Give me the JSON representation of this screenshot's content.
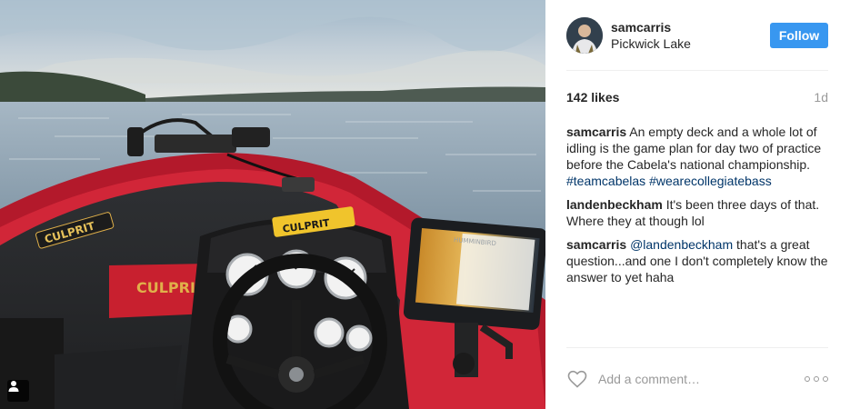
{
  "post": {
    "author": {
      "username": "samcarris",
      "location": "Pickwick Lake",
      "avatar_icon": "avatar"
    },
    "follow_label": "Follow",
    "likes": "142 likes",
    "time": "1d",
    "photo_overlay_text": {
      "console_brand": "CULPRIT",
      "hull_brand": "CULPRIT",
      "gauge_pod_brand": "CULPRIT",
      "graph_brand": "HUMMINBIRD"
    },
    "comments": [
      {
        "author": "samcarris",
        "parts": [
          "An empty deck and a whole lot of idling is the game plan for day two of practice before the Cabela's national championship. ",
          "#teamcabelas",
          " ",
          "#wearecollegiatebass"
        ]
      },
      {
        "author": "landenbeckham",
        "parts": [
          "It's been three days of that. Where they at though lol"
        ]
      },
      {
        "author": "samcarris",
        "parts": [
          "@landenbeckham",
          " that's a great question...and one I don't completely know the answer to yet haha"
        ]
      }
    ],
    "add_comment_placeholder": "Add a comment…"
  },
  "icons": {
    "like": "heart-icon",
    "more": "more-options-icon",
    "user_tag": "user-tag-icon"
  },
  "colors": {
    "follow_button": "#3897f0",
    "hashtag": "#003569",
    "muted": "#999999",
    "divider": "#efefef"
  }
}
